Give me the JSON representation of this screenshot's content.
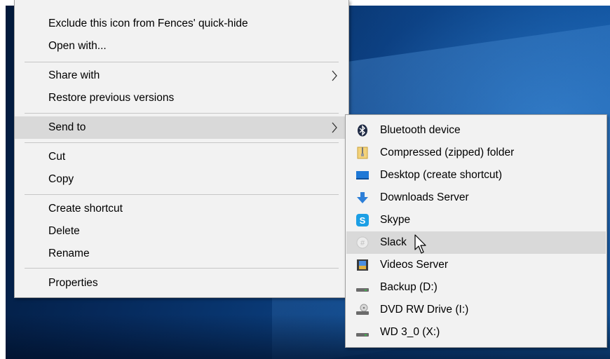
{
  "context_menu": {
    "items": [
      {
        "label": "Exclude this icon from Fences' quick-hide"
      },
      {
        "label": "Open with..."
      },
      {
        "label": "Share with"
      },
      {
        "label": "Restore previous versions"
      },
      {
        "label": "Send to"
      },
      {
        "label": "Cut"
      },
      {
        "label": "Copy"
      },
      {
        "label": "Create shortcut"
      },
      {
        "label": "Delete"
      },
      {
        "label": "Rename"
      },
      {
        "label": "Properties"
      }
    ]
  },
  "send_to_menu": {
    "items": [
      {
        "label": "Bluetooth device",
        "icon": "bluetooth-icon"
      },
      {
        "label": "Compressed (zipped) folder",
        "icon": "zip-folder-icon"
      },
      {
        "label": "Desktop (create shortcut)",
        "icon": "desktop-icon"
      },
      {
        "label": "Downloads Server",
        "icon": "download-arrow-icon"
      },
      {
        "label": "Skype",
        "icon": "skype-icon"
      },
      {
        "label": "Slack",
        "icon": "slack-icon"
      },
      {
        "label": "Videos Server",
        "icon": "film-icon"
      },
      {
        "label": "Backup (D:)",
        "icon": "drive-icon"
      },
      {
        "label": "DVD RW Drive (I:)",
        "icon": "dvd-drive-icon"
      },
      {
        "label": "WD 3_0 (X:)",
        "icon": "drive-icon"
      }
    ]
  },
  "colors": {
    "menu_bg": "#f2f2f2",
    "highlight": "#d9d9d9",
    "accent_blue": "#1e78d6"
  }
}
